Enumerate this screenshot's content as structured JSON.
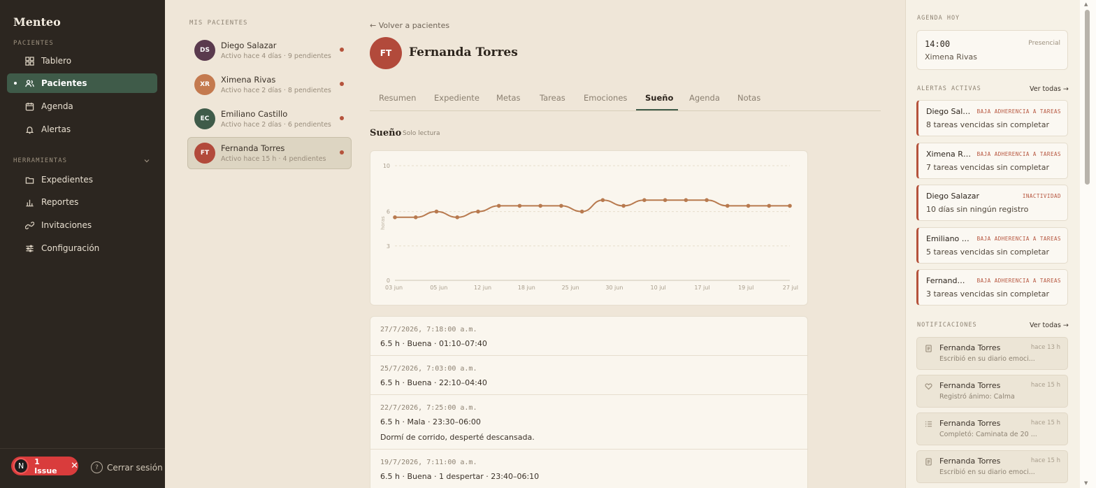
{
  "sidebar": {
    "brand": "Menteo",
    "section_patients": "PACIENTES",
    "section_tools": "HERRAMIENTAS",
    "nav": [
      {
        "label": "Tablero",
        "icon": "grid-icon"
      },
      {
        "label": "Pacientes",
        "icon": "users-icon"
      },
      {
        "label": "Agenda",
        "icon": "calendar-icon"
      },
      {
        "label": "Alertas",
        "icon": "bell-icon"
      }
    ],
    "tools": [
      {
        "label": "Expedientes",
        "icon": "folder-icon"
      },
      {
        "label": "Reportes",
        "icon": "bar-chart-icon"
      },
      {
        "label": "Invitaciones",
        "icon": "link-icon"
      },
      {
        "label": "Configuración",
        "icon": "sliders-icon"
      }
    ],
    "logout": "Cerrar sesión",
    "issue_badge": "1 Issue",
    "issue_letter": "N"
  },
  "patients": {
    "label": "MIS PACIENTES",
    "items": [
      {
        "initials": "DS",
        "name": "Diego Salazar",
        "status": "Activo hace 4 días · 9 pendientes",
        "color": "#5a3a4e"
      },
      {
        "initials": "XR",
        "name": "Ximena Rivas",
        "status": "Activo hace 2 días · 8 pendientes",
        "color": "#c47a4f"
      },
      {
        "initials": "EC",
        "name": "Emiliano Castillo",
        "status": "Activo hace 2 días · 6 pendientes",
        "color": "#3f5b49"
      },
      {
        "initials": "FT",
        "name": "Fernanda Torres",
        "status": "Activo hace 15 h · 4 pendientes",
        "color": "#b24a3b"
      }
    ]
  },
  "main": {
    "back": "← Volver a pacientes",
    "initials": "FT",
    "name": "Fernanda Torres",
    "tabs": [
      "Resumen",
      "Expediente",
      "Metas",
      "Tareas",
      "Emociones",
      "Sueño",
      "Agenda",
      "Notas"
    ],
    "active_tab": "Sueño",
    "section_title": "Sueño",
    "section_sub": "Solo lectura",
    "entries": [
      {
        "ts": "27/7/2026, 7:18:00 a.m.",
        "detail": "6.5 h · Buena · 01:10–07:40",
        "note": ""
      },
      {
        "ts": "25/7/2026, 7:03:00 a.m.",
        "detail": "6.5 h · Buena · 22:10–04:40",
        "note": ""
      },
      {
        "ts": "22/7/2026, 7:25:00 a.m.",
        "detail": "6.5 h · Mala · 23:30–06:00",
        "note": "Dormí de corrido, desperté descansada."
      },
      {
        "ts": "19/7/2026, 7:11:00 a.m.",
        "detail": "6.5 h · Buena · 1 despertar · 23:40–06:10",
        "note": ""
      }
    ]
  },
  "chart_data": {
    "type": "line",
    "ylabel": "horas",
    "ylim": [
      0,
      10
    ],
    "yticks": [
      0,
      3,
      6,
      10
    ],
    "xticks": [
      "03 jun",
      "05 jun",
      "12 jun",
      "18 jun",
      "25 jun",
      "30 jun",
      "10 jul",
      "17 jul",
      "19 jul",
      "27 jul"
    ],
    "values": [
      5.5,
      5.5,
      6,
      5.5,
      6,
      6.5,
      6.5,
      6.5,
      6.5,
      6,
      7,
      6.5,
      7,
      7,
      7,
      7,
      6.5,
      6.5,
      6.5,
      6.5
    ],
    "color": "#b87a4f"
  },
  "right": {
    "agenda_label": "AGENDA HOY",
    "agenda": {
      "time": "14:00",
      "mode": "Presencial",
      "who": "Ximena Rivas"
    },
    "alerts_label": "ALERTAS ACTIVAS",
    "see_all": "Ver todas →",
    "alerts": [
      {
        "name": "Diego Salazar",
        "type": "BAJA ADHERENCIA A TAREAS",
        "desc": "8 tareas vencidas sin completar"
      },
      {
        "name": "Ximena Rivas",
        "type": "BAJA ADHERENCIA A TAREAS",
        "desc": "7 tareas vencidas sin completar"
      },
      {
        "name": "Diego Salazar",
        "type": "INACTIVIDAD",
        "desc": "10 días sin ningún registro"
      },
      {
        "name": "Emiliano Castillo",
        "type": "BAJA ADHERENCIA A TAREAS",
        "desc": "5 tareas vencidas sin completar"
      },
      {
        "name": "Fernanda Torres",
        "type": "BAJA ADHERENCIA A TAREAS",
        "desc": "3 tareas vencidas sin completar"
      }
    ],
    "notif_label": "NOTIFICACIONES",
    "notifications": [
      {
        "icon": "document-icon",
        "name": "Fernanda Torres",
        "time": "hace 13 h",
        "desc": "Escribió en su diario emoci..."
      },
      {
        "icon": "heart-icon",
        "name": "Fernanda Torres",
        "time": "hace 15 h",
        "desc": "Registró ánimo: Calma"
      },
      {
        "icon": "checklist-icon",
        "name": "Fernanda Torres",
        "time": "hace 15 h",
        "desc": "Completó: Caminata de 20 ..."
      },
      {
        "icon": "document-icon",
        "name": "Fernanda Torres",
        "time": "hace 15 h",
        "desc": "Escribió en su diario emoci..."
      }
    ]
  }
}
